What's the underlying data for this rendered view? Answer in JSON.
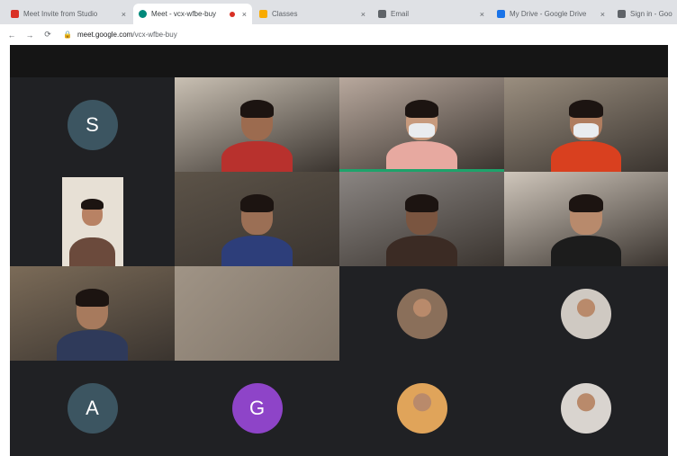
{
  "browser": {
    "tabs": [
      {
        "label": "Meet Invite from Studio",
        "close": "×",
        "favicon_color": "#d93025",
        "active": false
      },
      {
        "label": "Meet - vcx-wfbe-buy",
        "close": "×",
        "favicon_color": "#00897b",
        "active": true,
        "recording": true
      },
      {
        "label": "Classes",
        "close": "×",
        "favicon_color": "#f9ab00",
        "active": false
      },
      {
        "label": "Email",
        "close": "×",
        "favicon_color": "#5f6368",
        "active": false
      },
      {
        "label": "My Drive - Google Drive",
        "close": "×",
        "favicon_color": "#1a73e8",
        "active": false
      },
      {
        "label": "Sign in - Goo",
        "close": "",
        "favicon_color": "#5f6368",
        "active": false
      }
    ],
    "nav": {
      "back": "←",
      "forward": "→",
      "reload": "⟳",
      "lock": "🔒"
    },
    "url": {
      "domain": "meet.google.com",
      "path": "/vcx-wfbe-buy"
    }
  },
  "meeting": {
    "participants": [
      {
        "initial": "S",
        "avatar_color": "#3c5561",
        "tile_type": "avatar"
      },
      {
        "tile_type": "video",
        "skin": "#9c6b4f",
        "shirt": "#b8312d",
        "bg": "#c9c0b3"
      },
      {
        "tile_type": "video",
        "skin": "#c79a7d",
        "shirt": "#e7a9a0",
        "bg": "#b8a89d",
        "speaking": true,
        "mask": true
      },
      {
        "tile_type": "video",
        "skin": "#b07d5f",
        "shirt": "#d9401f",
        "bg": "#9a8e7f",
        "mask": true
      },
      {
        "tile_type": "video-small",
        "skin": "#b88264",
        "shirt": "#6b4a3c",
        "bg": "#e7e0d5"
      },
      {
        "tile_type": "video",
        "skin": "#9b6f55",
        "shirt": "#2d3e7a",
        "bg": "#5c5348"
      },
      {
        "tile_type": "video",
        "skin": "#7a5540",
        "shirt": "#3b2b24",
        "bg": "#8a8582"
      },
      {
        "tile_type": "video",
        "skin": "#b88a6c",
        "shirt": "#1c1c1c",
        "bg": "#cfc6bb"
      },
      {
        "tile_type": "video",
        "skin": "#a77a5d",
        "shirt": "#2f3a5a",
        "bg": "#7b6b58"
      },
      {
        "tile_type": "video-blank",
        "bg": "#a09486"
      },
      {
        "tile_type": "photo",
        "photo_color": "#8a6f5a"
      },
      {
        "tile_type": "photo",
        "photo_color": "#cfc9c2"
      },
      {
        "initial": "A",
        "avatar_color": "#3c5561",
        "tile_type": "avatar"
      },
      {
        "initial": "G",
        "avatar_color": "#8e44c8",
        "tile_type": "avatar"
      },
      {
        "tile_type": "photo",
        "photo_color": "#e0a45a"
      },
      {
        "tile_type": "photo",
        "photo_color": "#d9d4cf"
      }
    ]
  }
}
